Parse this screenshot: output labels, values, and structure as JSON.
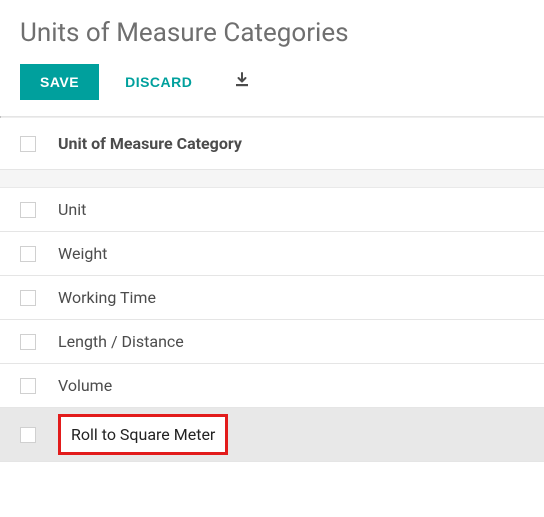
{
  "header": {
    "title": "Units of Measure Categories"
  },
  "toolbar": {
    "save_label": "Save",
    "discard_label": "Discard",
    "export_name": "export-icon"
  },
  "table": {
    "column_header": "Unit of Measure Category",
    "rows": [
      {
        "label": "Unit",
        "editing": false
      },
      {
        "label": "Weight",
        "editing": false
      },
      {
        "label": "Working Time",
        "editing": false
      },
      {
        "label": "Length / Distance",
        "editing": false
      },
      {
        "label": "Volume",
        "editing": false
      },
      {
        "label": "Roll to Square Meter",
        "editing": true
      }
    ]
  }
}
